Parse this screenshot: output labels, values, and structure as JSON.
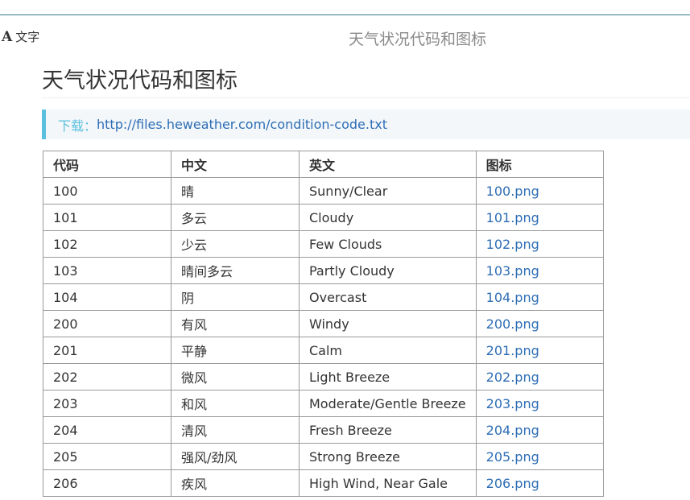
{
  "toolbar": {
    "font_glyph": "A",
    "font_label": "文字",
    "header_title": "天气状况代码和图标"
  },
  "page": {
    "title": "天气状况代码和图标",
    "download_label": "下载：",
    "download_link": "http://files.heweather.com/condition-code.txt"
  },
  "table": {
    "headers": [
      "代码",
      "中文",
      "英文",
      "图标"
    ],
    "rows": [
      [
        "100",
        "晴",
        "Sunny/Clear",
        "100.png"
      ],
      [
        "101",
        "多云",
        "Cloudy",
        "101.png"
      ],
      [
        "102",
        "少云",
        "Few Clouds",
        "102.png"
      ],
      [
        "103",
        "晴间多云",
        "Partly Cloudy",
        "103.png"
      ],
      [
        "104",
        "阴",
        "Overcast",
        "104.png"
      ],
      [
        "200",
        "有风",
        "Windy",
        "200.png"
      ],
      [
        "201",
        "平静",
        "Calm",
        "201.png"
      ],
      [
        "202",
        "微风",
        "Light Breeze",
        "202.png"
      ],
      [
        "203",
        "和风",
        "Moderate/Gentle Breeze",
        "203.png"
      ],
      [
        "204",
        "清风",
        "Fresh Breeze",
        "204.png"
      ],
      [
        "205",
        "强风/劲风",
        "Strong Breeze",
        "205.png"
      ],
      [
        "206",
        "疾风",
        "High Wind, Near Gale",
        "206.png"
      ]
    ]
  }
}
